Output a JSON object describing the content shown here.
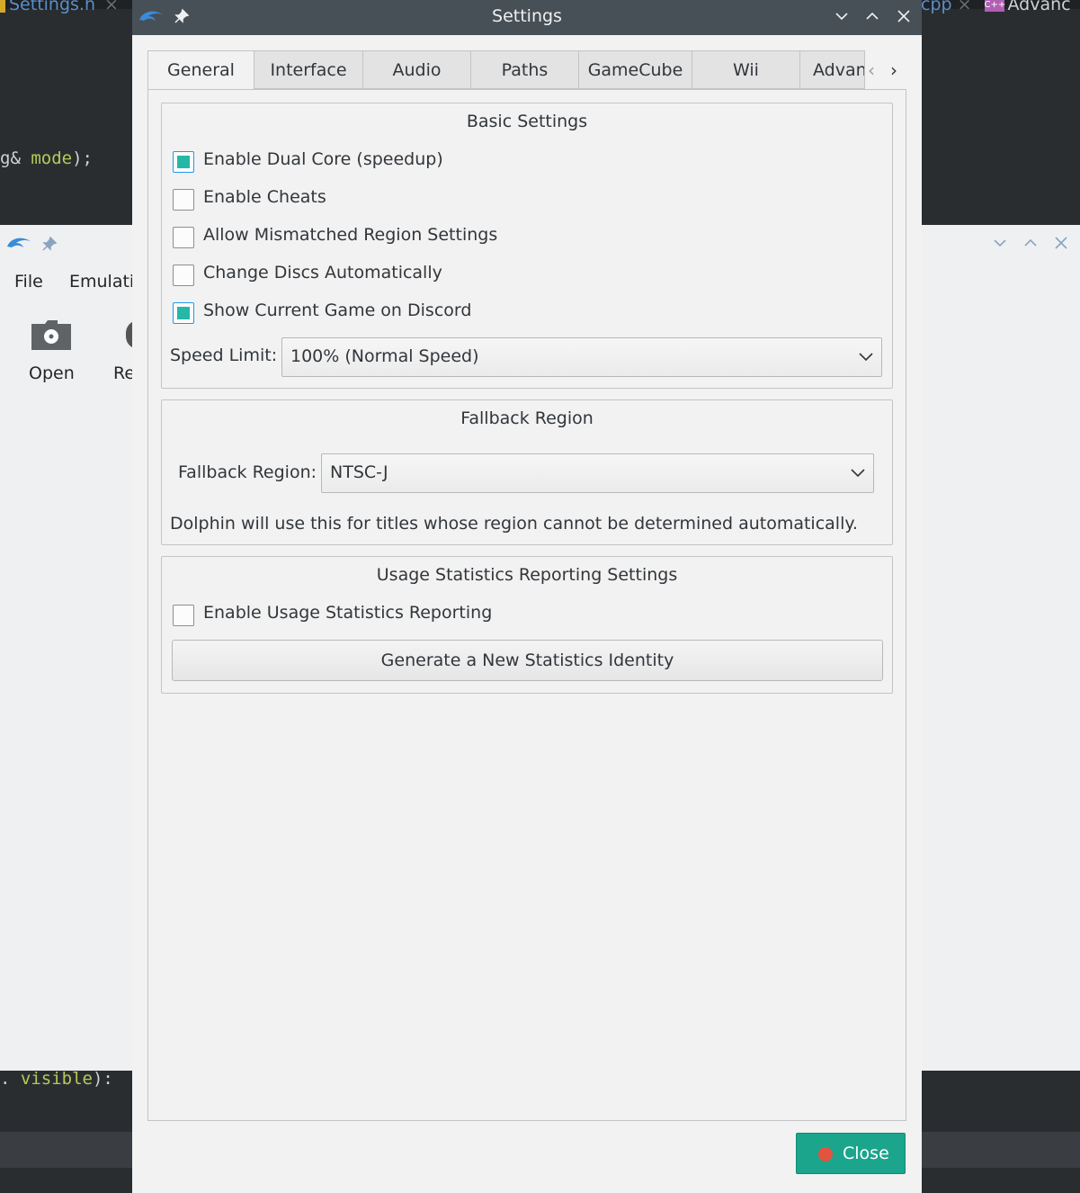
{
  "editor": {
    "tab_left": "Settings.h",
    "tab_right_ext": "cpp",
    "tab_right_badge": "C++",
    "tab_right_name": "Advanc",
    "close_glyph": "×",
    "code_line_top_a": "g& ",
    "code_line_top_kw": "mode",
    "code_line_top_b": ");",
    "code_line_bottom_a": ". ",
    "code_line_bottom_kw": "visible",
    "code_line_bottom_b": "):"
  },
  "main_window": {
    "menu": [
      "File",
      "Emulati"
    ],
    "toolbar": [
      {
        "label": "Open",
        "icon": "folder-disc-icon"
      },
      {
        "label": "Re",
        "icon": "refresh-icon"
      }
    ]
  },
  "dialog": {
    "title": "Settings",
    "tabs": [
      {
        "label": "General",
        "active": true
      },
      {
        "label": "Interface",
        "active": false
      },
      {
        "label": "Audio",
        "active": false
      },
      {
        "label": "Paths",
        "active": false
      },
      {
        "label": "GameCube",
        "active": false
      },
      {
        "label": "Wii",
        "active": false
      },
      {
        "label": "Advan",
        "active": false
      }
    ],
    "tab_scroll_left": "‹",
    "tab_scroll_right": "›",
    "basic": {
      "title": "Basic Settings",
      "options": [
        {
          "label": "Enable Dual Core (speedup)",
          "checked": true
        },
        {
          "label": "Enable Cheats",
          "checked": false
        },
        {
          "label": "Allow Mismatched Region Settings",
          "checked": false
        },
        {
          "label": "Change Discs Automatically",
          "checked": false
        },
        {
          "label": "Show Current Game on Discord",
          "checked": true
        }
      ],
      "speed_label": "Speed Limit:",
      "speed_value": "100% (Normal Speed)"
    },
    "fallback": {
      "title": "Fallback Region",
      "label": "Fallback Region:",
      "value": "NTSC-J",
      "description": "Dolphin will use this for titles whose region cannot be determined automatically."
    },
    "usage": {
      "title": "Usage Statistics Reporting Settings",
      "checkbox_label": "Enable Usage Statistics Reporting",
      "checked": false,
      "button_label": "Generate a New Statistics Identity"
    },
    "close_label": "Close"
  },
  "colors": {
    "title_bar": "#475057",
    "accent_check": "#26b8a6",
    "close_button": "#1aa58c",
    "close_icon": "#e2543f"
  }
}
